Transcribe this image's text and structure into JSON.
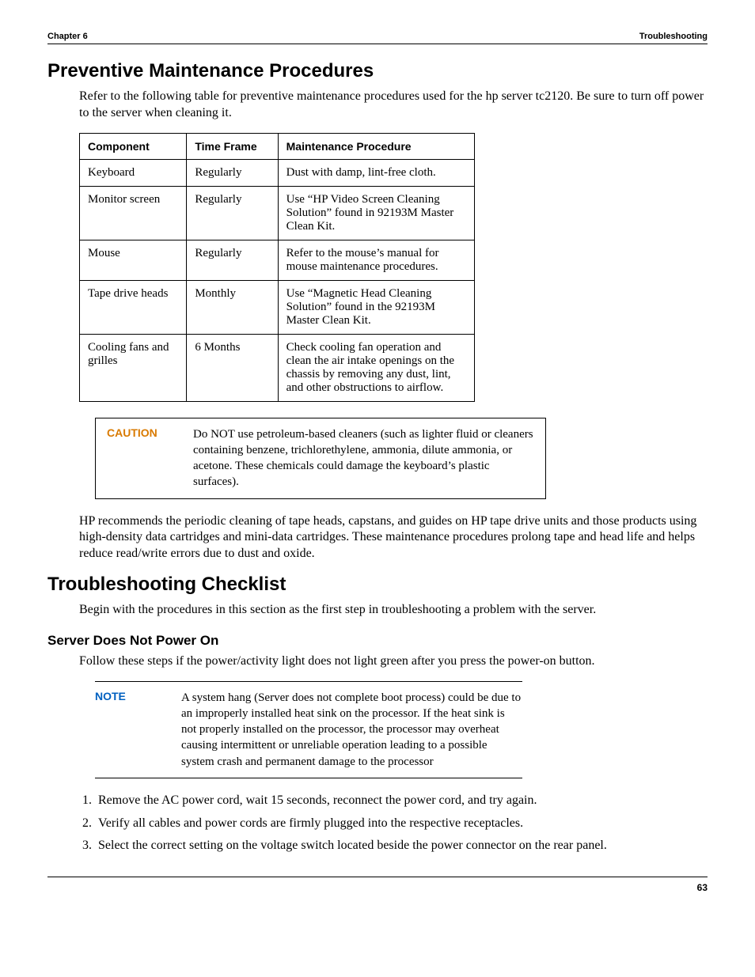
{
  "header": {
    "left": "Chapter 6",
    "right": "Troubleshooting"
  },
  "section1": {
    "title": "Preventive Maintenance Procedures",
    "intro": "Refer to the following table for preventive maintenance procedures used for the hp server tc2120. Be sure to turn off power to the server when cleaning it.",
    "table_headers": {
      "c0": "Component",
      "c1": "Time Frame",
      "c2": "Maintenance Procedure"
    },
    "table_rows": [
      {
        "c0": "Keyboard",
        "c1": "Regularly",
        "c2": "Dust with damp, lint-free cloth."
      },
      {
        "c0": "Monitor screen",
        "c1": "Regularly",
        "c2": "Use “HP Video Screen Cleaning Solution” found in 92193M Master Clean Kit."
      },
      {
        "c0": "Mouse",
        "c1": "Regularly",
        "c2": "Refer to the mouse’s manual for mouse maintenance procedures."
      },
      {
        "c0": "Tape drive heads",
        "c1": "Monthly",
        "c2": "Use “Magnetic Head Cleaning Solution” found in the 92193M Master Clean Kit."
      },
      {
        "c0": "Cooling fans and grilles",
        "c1": "6 Months",
        "c2": "Check cooling fan operation and clean the air intake openings on the chassis by removing any dust, lint, and other obstructions to airflow."
      }
    ],
    "caution_label": "CAUTION",
    "caution_text": "Do NOT use petroleum-based cleaners (such as lighter fluid or cleaners containing benzene, trichlorethylene, ammonia, dilute ammonia, or acetone. These chemicals could damage the keyboard’s plastic surfaces).",
    "after": "HP recommends the periodic cleaning of tape heads, capstans, and guides on HP tape drive units and those products using high-density data cartridges and mini-data cartridges. These maintenance procedures prolong tape and head life and helps reduce read/write errors due to dust and oxide."
  },
  "section2": {
    "title": "Troubleshooting Checklist",
    "intro": "Begin with the procedures in this section as the first step in troubleshooting a problem with the server.",
    "sub_title": "Server Does Not Power On",
    "sub_intro": "Follow these steps if the power/activity light does not light green after you press the power-on button.",
    "note_label": "NOTE",
    "note_text": "A system hang (Server does not complete boot process) could be due to an improperly installed heat sink on the processor. If the heat sink is not properly installed on the processor, the processor may overheat causing intermittent or unreliable operation leading to a possible system crash and permanent damage to the processor",
    "steps": [
      "Remove the AC power cord, wait 15 seconds, reconnect the power cord, and try again.",
      "Verify all cables and power cords are firmly plugged into the respective receptacles.",
      "Select the correct setting on the voltage switch located beside the power connector on the rear panel."
    ]
  },
  "footer": {
    "page": "63"
  }
}
